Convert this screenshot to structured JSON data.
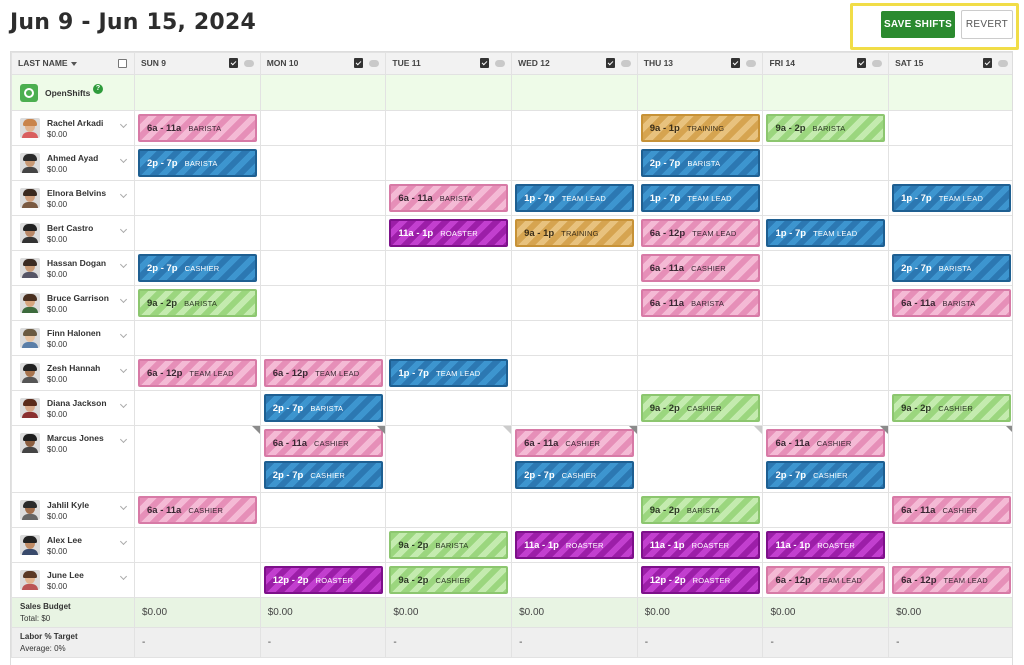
{
  "header": {
    "title": "Jun 9 - Jun 15, 2024",
    "save_label": "SAVE SHIFTS",
    "revert_label": "REVERT"
  },
  "colors": {
    "save_button": "#2b8a2f",
    "highlight_border": "#f1dd47",
    "shift_blue": "#2c78b2",
    "shift_pink": "#e68fb8",
    "shift_green": "#9bd67e",
    "shift_orange": "#d6a450",
    "shift_purple": "#9c1ea8"
  },
  "columns": {
    "name_header": "LAST NAME",
    "days": [
      "SUN 9",
      "MON 10",
      "TUE 11",
      "WED 12",
      "THU 13",
      "FRI 14",
      "SAT 15"
    ]
  },
  "open_shifts": {
    "label": "OpenShifts",
    "help": "?"
  },
  "employees": [
    {
      "name": "Rachel Arkadi",
      "wage": "$0.00"
    },
    {
      "name": "Ahmed Ayad",
      "wage": "$0.00"
    },
    {
      "name": "Elnora Belvins",
      "wage": "$0.00"
    },
    {
      "name": "Bert Castro",
      "wage": "$0.00"
    },
    {
      "name": "Hassan Dogan",
      "wage": "$0.00"
    },
    {
      "name": "Bruce Garrison",
      "wage": "$0.00"
    },
    {
      "name": "Finn Halonen",
      "wage": "$0.00"
    },
    {
      "name": "Zesh Hannah",
      "wage": "$0.00"
    },
    {
      "name": "Diana Jackson",
      "wage": "$0.00"
    },
    {
      "name": "Marcus Jones",
      "wage": "$0.00"
    },
    {
      "name": "Jahlil Kyle",
      "wage": "$0.00"
    },
    {
      "name": "Alex Lee",
      "wage": "$0.00"
    },
    {
      "name": "June Lee",
      "wage": "$0.00"
    }
  ],
  "shifts": {
    "r0d0": {
      "time": "6a - 11a",
      "role": "BARISTA",
      "color": "pink"
    },
    "r0d4": {
      "time": "9a - 1p",
      "role": "TRAINING",
      "color": "orange"
    },
    "r0d5": {
      "time": "9a - 2p",
      "role": "BARISTA",
      "color": "green"
    },
    "r1d0": {
      "time": "2p - 7p",
      "role": "BARISTA",
      "color": "blue"
    },
    "r1d4": {
      "time": "2p - 7p",
      "role": "BARISTA",
      "color": "blue"
    },
    "r2d2": {
      "time": "6a - 11a",
      "role": "BARISTA",
      "color": "pink"
    },
    "r2d3": {
      "time": "1p - 7p",
      "role": "TEAM LEAD",
      "color": "blue"
    },
    "r2d4": {
      "time": "1p - 7p",
      "role": "TEAM LEAD",
      "color": "blue"
    },
    "r2d6": {
      "time": "1p - 7p",
      "role": "TEAM LEAD",
      "color": "blue"
    },
    "r3d2": {
      "time": "11a - 1p",
      "role": "ROASTER",
      "color": "purple"
    },
    "r3d3": {
      "time": "9a - 1p",
      "role": "TRAINING",
      "color": "orange"
    },
    "r3d4": {
      "time": "6a - 12p",
      "role": "TEAM LEAD",
      "color": "pink"
    },
    "r3d5": {
      "time": "1p - 7p",
      "role": "TEAM LEAD",
      "color": "blue"
    },
    "r4d0": {
      "time": "2p - 7p",
      "role": "CASHIER",
      "color": "blue"
    },
    "r4d4": {
      "time": "6a - 11a",
      "role": "CASHIER",
      "color": "pink"
    },
    "r4d6": {
      "time": "2p - 7p",
      "role": "BARISTA",
      "color": "blue"
    },
    "r5d0": {
      "time": "9a - 2p",
      "role": "BARISTA",
      "color": "green"
    },
    "r5d4": {
      "time": "6a - 11a",
      "role": "BARISTA",
      "color": "pink"
    },
    "r5d6": {
      "time": "6a - 11a",
      "role": "BARISTA",
      "color": "pink"
    },
    "r7d0": {
      "time": "6a - 12p",
      "role": "TEAM LEAD",
      "color": "pink"
    },
    "r7d1": {
      "time": "6a - 12p",
      "role": "TEAM LEAD",
      "color": "pink"
    },
    "r7d2": {
      "time": "1p - 7p",
      "role": "TEAM LEAD",
      "color": "blue"
    },
    "r8d1": {
      "time": "2p - 7p",
      "role": "BARISTA",
      "color": "blue"
    },
    "r8d4": {
      "time": "9a - 2p",
      "role": "CASHIER",
      "color": "green"
    },
    "r8d6": {
      "time": "9a - 2p",
      "role": "CASHIER",
      "color": "green"
    },
    "r9d1a": {
      "time": "6a - 11a",
      "role": "CASHIER",
      "color": "pink"
    },
    "r9d1b": {
      "time": "2p - 7p",
      "role": "CASHIER",
      "color": "blue"
    },
    "r9d3a": {
      "time": "6a - 11a",
      "role": "CASHIER",
      "color": "pink"
    },
    "r9d3b": {
      "time": "2p - 7p",
      "role": "CASHIER",
      "color": "blue"
    },
    "r9d5a": {
      "time": "6a - 11a",
      "role": "CASHIER",
      "color": "pink"
    },
    "r9d5b": {
      "time": "2p - 7p",
      "role": "CASHIER",
      "color": "blue"
    },
    "r10d0": {
      "time": "6a - 11a",
      "role": "CASHIER",
      "color": "pink"
    },
    "r10d4": {
      "time": "9a - 2p",
      "role": "BARISTA",
      "color": "green"
    },
    "r10d6": {
      "time": "6a - 11a",
      "role": "CASHIER",
      "color": "pink"
    },
    "r11d2": {
      "time": "9a - 2p",
      "role": "BARISTA",
      "color": "green"
    },
    "r11d3": {
      "time": "11a - 1p",
      "role": "ROASTER",
      "color": "purple"
    },
    "r11d4": {
      "time": "11a - 1p",
      "role": "ROASTER",
      "color": "purple"
    },
    "r11d5": {
      "time": "11a - 1p",
      "role": "ROASTER",
      "color": "purple"
    },
    "r12d1": {
      "time": "12p - 2p",
      "role": "ROASTER",
      "color": "purple"
    },
    "r12d2": {
      "time": "9a - 2p",
      "role": "CASHIER",
      "color": "green"
    },
    "r12d4": {
      "time": "12p - 2p",
      "role": "ROASTER",
      "color": "purple"
    },
    "r12d5": {
      "time": "6a - 12p",
      "role": "TEAM LEAD",
      "color": "pink"
    },
    "r12d6": {
      "time": "6a - 12p",
      "role": "TEAM LEAD",
      "color": "pink"
    }
  },
  "footer": {
    "sales_label": "Sales Budget",
    "sales_total": "Total: $0",
    "sales_values": [
      "$0.00",
      "$0.00",
      "$0.00",
      "$0.00",
      "$0.00",
      "$0.00",
      "$0.00"
    ],
    "labor_label": "Labor % Target",
    "labor_avg": "Average: 0%",
    "labor_values": [
      "-",
      "-",
      "-",
      "-",
      "-",
      "-",
      "-"
    ]
  }
}
